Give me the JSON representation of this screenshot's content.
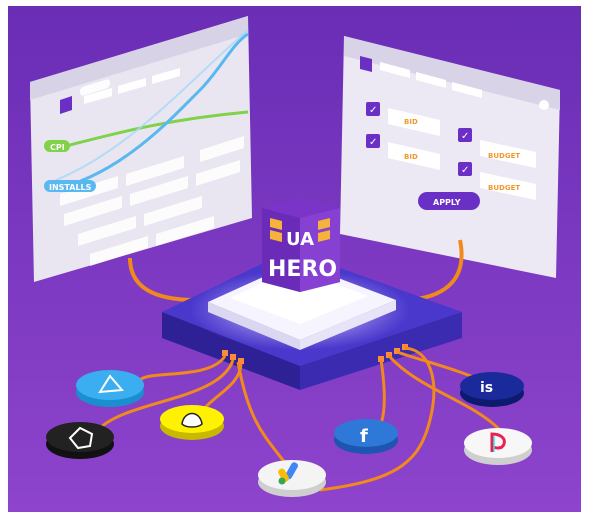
{
  "left_panel": {
    "cpi_label": "CPI",
    "installs_label": "INSTALLS"
  },
  "right_panel": {
    "rows": [
      {
        "left_label": "BID",
        "right_label": "BUDGET"
      },
      {
        "left_label": "BID",
        "right_label": "BUDGET"
      }
    ],
    "apply_label": "APPLY"
  },
  "logo": {
    "line1": "UA",
    "line2": "HERO"
  },
  "colors": {
    "background_top": "#6b2fb8",
    "background_bottom": "#8a3ec8",
    "checkbox": "#6a2fc4",
    "orange_text": "#f39a2e",
    "cable": "#f08a1c",
    "cpi_line": "#7fd24a",
    "installs_line": "#5ab8f0"
  },
  "network_icons": [
    "android-triangle-icon",
    "unity-icon",
    "snapchat-icon",
    "google-ads-icon",
    "facebook-icon",
    "ironsource-icon",
    "tiktok-icon"
  ]
}
